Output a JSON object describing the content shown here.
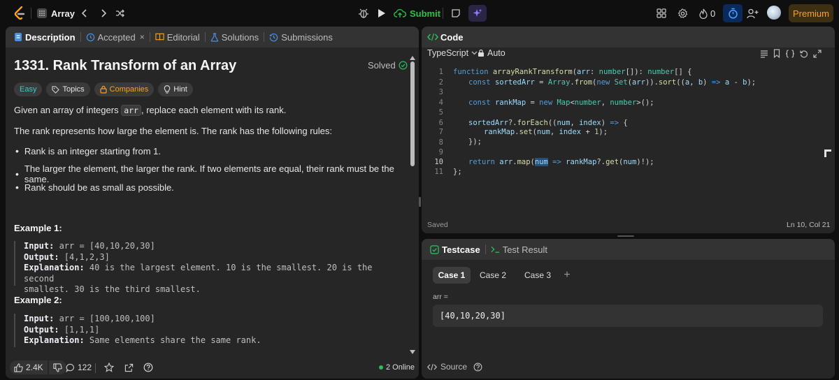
{
  "topbar": {
    "problem_list_label": "Array",
    "submit_label": "Submit",
    "streak_count": "0",
    "premium_label": "Premium"
  },
  "left_tabs": [
    {
      "label": "Description"
    },
    {
      "label": "Accepted"
    },
    {
      "label": "Editorial"
    },
    {
      "label": "Solutions"
    },
    {
      "label": "Submissions"
    }
  ],
  "problem": {
    "title": "1331. Rank Transform of an Array",
    "status": "Solved",
    "difficulty": "Easy",
    "tags": [
      "Topics",
      "Companies",
      "Hint"
    ],
    "intro_before": "Given an array of integers ",
    "intro_code": "arr",
    "intro_after": ", replace each element with its rank.",
    "rules_intro": "The rank represents how large the element is. The rank has the following rules:",
    "rules": [
      "Rank is an integer starting from 1.",
      "The larger the element, the larger the rank. If two elements are equal, their rank must be the same.",
      "Rank should be as small as possible."
    ],
    "example1_title": "Example 1:",
    "example1": {
      "input_label": "Input:",
      "input": " arr = [40,10,20,30]",
      "output_label": "Output:",
      "output": " [4,1,2,3]",
      "explanation_label": "Explanation:",
      "explanation": " 40 is the largest element. 10 is the smallest. 20 is the second",
      "explanation2": "smallest. 30 is the third smallest."
    },
    "example2_title": "Example 2:",
    "example2": {
      "input_label": "Input:",
      "input": " arr = [100,100,100]",
      "output_label": "Output:",
      "output": " [1,1,1]",
      "explanation_label": "Explanation:",
      "explanation": " Same elements share the same rank."
    }
  },
  "left_footer": {
    "likes": "2.4K",
    "comments": "122",
    "online": "2 Online"
  },
  "code_panel": {
    "title": "Code",
    "language": "TypeScript",
    "mode": "Auto",
    "saved": "Saved",
    "cursor": "Ln 10, Col 21",
    "line_numbers": [
      "1",
      "2",
      "3",
      "4",
      "5",
      "6",
      "7",
      "8",
      "9",
      "10",
      "11"
    ]
  },
  "testcase_panel": {
    "tab_testcase": "Testcase",
    "tab_result": "Test Result",
    "cases": [
      "Case 1",
      "Case 2",
      "Case 3"
    ],
    "add_label": "+",
    "param_label": "arr =",
    "param_value": "[40,10,20,30]",
    "source_label": "Source"
  },
  "colors": {
    "accent_orange": "#ffa116",
    "easy_teal": "#46c6c2",
    "solved_green": "#2cbb5d",
    "submit_green": "#28c244",
    "tab_blue": "#007aff"
  }
}
